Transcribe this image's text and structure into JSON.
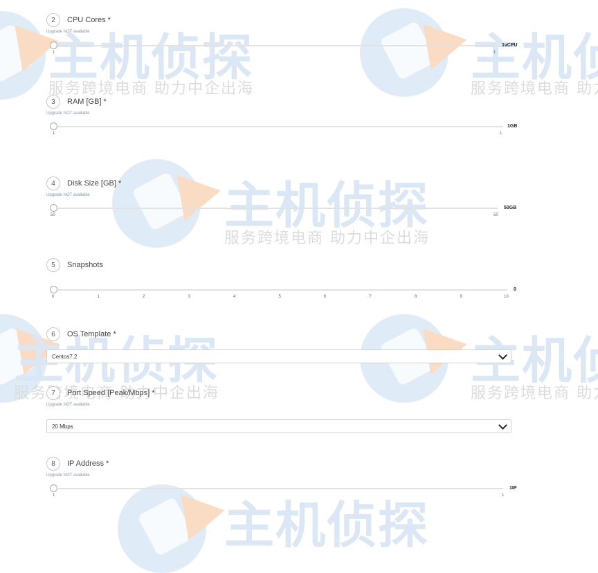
{
  "watermark": {
    "big_text": "主机侦探",
    "slogan": "服务跨境电商 助力中企出海"
  },
  "fields": {
    "cpu": {
      "step": "2",
      "label": "CPU Cores *",
      "note": "Upgrade NOT available",
      "value": "1vCPU",
      "min_tick": "1",
      "max_tick": "1"
    },
    "ram": {
      "step": "3",
      "label": "RAM [GB] *",
      "note": "Upgrade NOT available",
      "value": "1GB",
      "min_tick": "1",
      "max_tick": "1"
    },
    "disk": {
      "step": "4",
      "label": "Disk Size [GB] *",
      "note": "Upgrade NOT available",
      "value": "50GB",
      "min_tick": "50",
      "max_tick": "50"
    },
    "snapshots": {
      "step": "5",
      "label": "Snapshots",
      "value": "0",
      "ticks": [
        "0",
        "1",
        "2",
        "3",
        "4",
        "5",
        "6",
        "7",
        "8",
        "9",
        "10"
      ]
    },
    "os": {
      "step": "6",
      "label": "OS Template *",
      "selected": "Centos7.2"
    },
    "port": {
      "step": "7",
      "label": "Port Speed [Peak/Mbps] *",
      "note": "Upgrade NOT available",
      "selected": "20 Mbps"
    },
    "ip": {
      "step": "8",
      "label": "IP Address *",
      "note": "Upgrade NOT available",
      "value": "1IP",
      "min_tick": "1",
      "max_tick": "1"
    }
  },
  "colors": {
    "tick_blue": "#2f6fb0",
    "track": "#e2e2e2",
    "watermark_blue": "#dbe7f4",
    "watermark_orange": "#f9dcc3"
  }
}
